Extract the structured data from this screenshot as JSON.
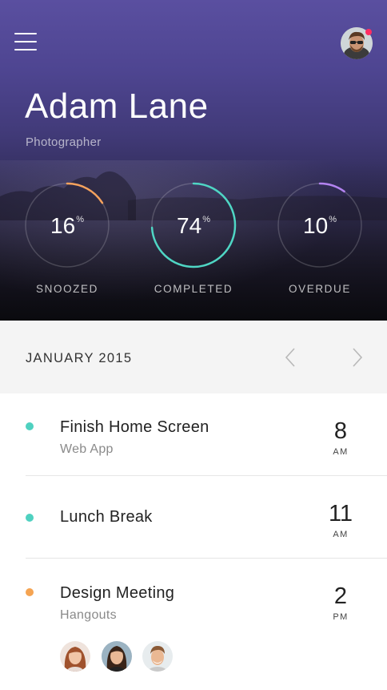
{
  "header": {
    "menu_icon": "hamburger-menu-icon",
    "avatar_icon": "user-avatar-icon",
    "name": "Adam Lane",
    "role": "Photographer"
  },
  "stats": [
    {
      "value": "16",
      "unit": "%",
      "label": "SNOOZED",
      "percent": 16,
      "color": "#f5a25d"
    },
    {
      "value": "74",
      "unit": "%",
      "label": "COMPLETED",
      "percent": 74,
      "color": "#4fd6c4"
    },
    {
      "value": "10",
      "unit": "%",
      "label": "OVERDUE",
      "percent": 10,
      "color": "#b383f0"
    }
  ],
  "calendar": {
    "month": "JANUARY 2015",
    "prev_icon": "chevron-left-icon",
    "next_icon": "chevron-right-icon"
  },
  "events": [
    {
      "title": "Finish Home Screen",
      "subtitle": "Web App",
      "time": "8",
      "ampm": "AM",
      "dot_color": "#4fd1c0"
    },
    {
      "title": "Lunch Break",
      "subtitle": "",
      "time": "11",
      "ampm": "AM",
      "dot_color": "#4fd1c0"
    },
    {
      "title": "Design Meeting",
      "subtitle": "Hangouts",
      "time": "2",
      "ampm": "PM",
      "dot_color": "#f5a452"
    }
  ],
  "colors": {
    "accent_snoozed": "#f5a25d",
    "accent_completed": "#4fd6c4",
    "accent_overdue": "#b383f0",
    "notification": "#ff2d62"
  }
}
